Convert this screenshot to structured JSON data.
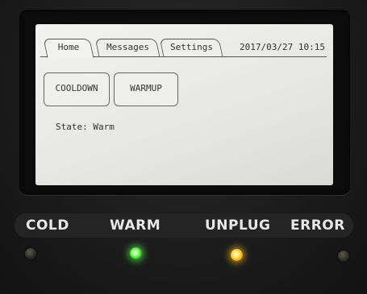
{
  "screen": {
    "tabs": [
      {
        "label": "Home",
        "active": true
      },
      {
        "label": "Messages",
        "active": false
      },
      {
        "label": "Settings",
        "active": false
      }
    ],
    "datetime": "2017/03/27  10:15",
    "buttons": {
      "cooldown": "COOLDOWN",
      "warmup": "WARMUP"
    },
    "state_text": "State: Warm"
  },
  "indicators": [
    {
      "label": "COLD",
      "lit": false,
      "color": "#2a2a22"
    },
    {
      "label": "WARM",
      "lit": true,
      "color": "#5aff50"
    },
    {
      "label": "UNPLUG",
      "lit": true,
      "color": "#ffc828"
    },
    {
      "label": "ERROR",
      "lit": false,
      "color": "#2a2a22"
    }
  ]
}
